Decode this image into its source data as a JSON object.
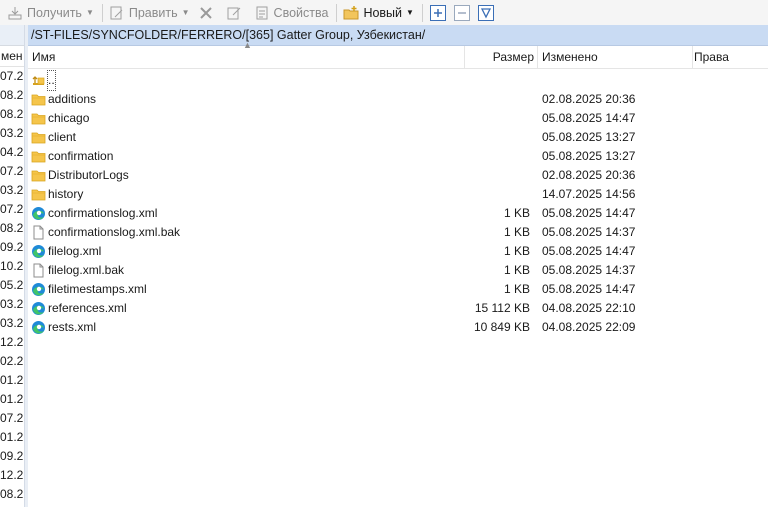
{
  "toolbar": {
    "get_label": "Получить",
    "edit_label": "Править",
    "properties_label": "Свойства",
    "new_label": "Новый"
  },
  "left_pane": {
    "header_partial": "мен",
    "dates_partial": [
      "07.2",
      "08.2",
      "08.2",
      "03.2",
      "04.2",
      "07.2",
      "03.2",
      "07.2",
      "08.2",
      "09.2",
      "10.2",
      "05.2",
      "03.2",
      "03.2",
      "12.2",
      "02.2",
      "01.2",
      "01.2",
      "07.2",
      "01.2",
      "09.2",
      "12.2",
      "08.2"
    ]
  },
  "path": "/ST-FILES/SYNCFOLDER/FERRERO/[365] Gatter Group, Узбекистан/",
  "columns": {
    "name": "Имя",
    "size": "Размер",
    "modified": "Изменено",
    "rights": "Права"
  },
  "files": [
    {
      "name": "..",
      "icon": "parent-dir-icon",
      "size": "",
      "modified": ""
    },
    {
      "name": "additions",
      "icon": "folder-icon",
      "size": "",
      "modified": "02.08.2025 20:36"
    },
    {
      "name": "chicago",
      "icon": "folder-icon",
      "size": "",
      "modified": "05.08.2025 14:47"
    },
    {
      "name": "client",
      "icon": "folder-icon",
      "size": "",
      "modified": "05.08.2025 13:27"
    },
    {
      "name": "confirmation",
      "icon": "folder-icon",
      "size": "",
      "modified": "05.08.2025 13:27"
    },
    {
      "name": "DistributorLogs",
      "icon": "folder-icon",
      "size": "",
      "modified": "02.08.2025 20:36"
    },
    {
      "name": "history",
      "icon": "folder-icon",
      "size": "",
      "modified": "14.07.2025 14:56"
    },
    {
      "name": "confirmationslog.xml",
      "icon": "edge-icon",
      "size": "1 KB",
      "modified": "05.08.2025 14:47"
    },
    {
      "name": "confirmationslog.xml.bak",
      "icon": "file-icon",
      "size": "1 KB",
      "modified": "05.08.2025 14:37"
    },
    {
      "name": "filelog.xml",
      "icon": "edge-icon",
      "size": "1 KB",
      "modified": "05.08.2025 14:47"
    },
    {
      "name": "filelog.xml.bak",
      "icon": "file-icon",
      "size": "1 KB",
      "modified": "05.08.2025 14:37"
    },
    {
      "name": "filetimestamps.xml",
      "icon": "edge-icon",
      "size": "1 KB",
      "modified": "05.08.2025 14:47"
    },
    {
      "name": "references.xml",
      "icon": "edge-icon",
      "size": "15 112 KB",
      "modified": "04.08.2025 22:10"
    },
    {
      "name": "rests.xml",
      "icon": "edge-icon",
      "size": "10 849 KB",
      "modified": "04.08.2025 22:09"
    }
  ]
}
